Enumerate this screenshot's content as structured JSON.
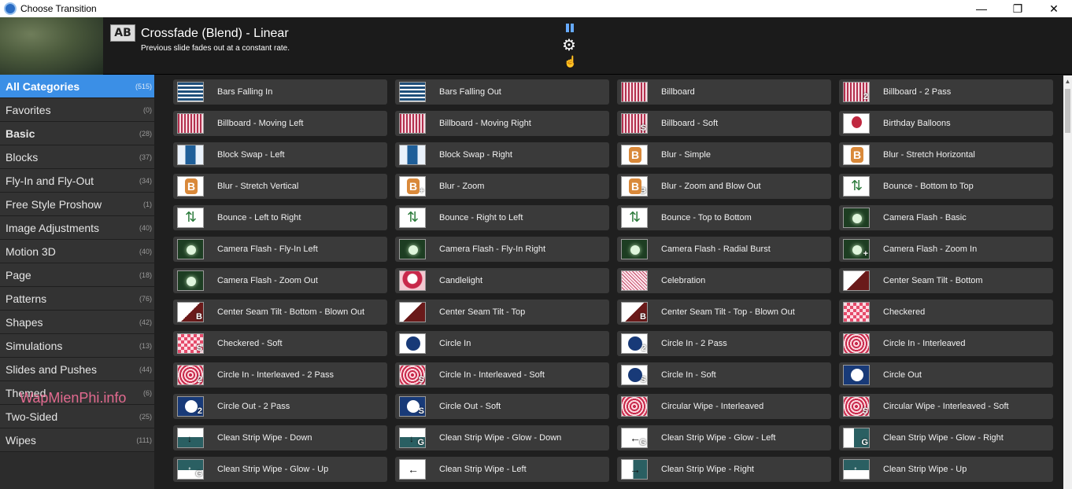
{
  "window": {
    "title": "Choose Transition",
    "controls": [
      "—",
      "❐",
      "✕"
    ]
  },
  "header": {
    "ab_icon_text": "AB",
    "title": "Crossfade (Blend) - Linear",
    "description": "Previous slide fades out at a constant rate."
  },
  "sidebar": {
    "categories": [
      {
        "name": "All Categories",
        "count": "(515)"
      },
      {
        "name": "Favorites",
        "count": "(0)"
      },
      {
        "name": "Basic",
        "count": "(28)"
      },
      {
        "name": "Blocks",
        "count": "(37)"
      },
      {
        "name": "Fly-In and Fly-Out",
        "count": "(34)"
      },
      {
        "name": "Free Style Proshow",
        "count": "(1)"
      },
      {
        "name": "Image Adjustments",
        "count": "(40)"
      },
      {
        "name": "Motion 3D",
        "count": "(40)"
      },
      {
        "name": "Page",
        "count": "(18)"
      },
      {
        "name": "Patterns",
        "count": "(76)"
      },
      {
        "name": "Shapes",
        "count": "(42)"
      },
      {
        "name": "Simulations",
        "count": "(13)"
      },
      {
        "name": "Slides and Pushes",
        "count": "(44)"
      },
      {
        "name": "Themed",
        "count": "(6)"
      },
      {
        "name": "Two-Sided",
        "count": "(25)"
      },
      {
        "name": "Wipes",
        "count": "(111)"
      }
    ],
    "watermark": "WapMienPhi.info"
  },
  "transitions": [
    {
      "label": "Bars Falling In",
      "icon": "bars-icon",
      "badge": ""
    },
    {
      "label": "Bars Falling Out",
      "icon": "bars-icon",
      "badge": ""
    },
    {
      "label": "Billboard",
      "icon": "billboard-icon",
      "badge": ""
    },
    {
      "label": "Billboard - 2 Pass",
      "icon": "billboard-icon",
      "badge": "2"
    },
    {
      "label": "Billboard - Moving Left",
      "icon": "billboard-icon",
      "badge": ""
    },
    {
      "label": "Billboard - Moving Right",
      "icon": "billboard-icon",
      "badge": ""
    },
    {
      "label": "Billboard - Soft",
      "icon": "billboard-icon",
      "badge": "S"
    },
    {
      "label": "Birthday Balloons",
      "icon": "balloon-icon",
      "badge": ""
    },
    {
      "label": "Block Swap - Left",
      "icon": "block-icon",
      "badge": ""
    },
    {
      "label": "Block Swap - Right",
      "icon": "block-icon",
      "badge": ""
    },
    {
      "label": "Blur - Simple",
      "icon": "blur-icon",
      "badge": ""
    },
    {
      "label": "Blur - Stretch Horizontal",
      "icon": "blur-icon",
      "badge": ""
    },
    {
      "label": "Blur - Stretch Vertical",
      "icon": "blur-icon",
      "badge": ""
    },
    {
      "label": "Blur - Zoom",
      "icon": "blur-icon",
      "badge": "+"
    },
    {
      "label": "Blur - Zoom and Blow Out",
      "icon": "blur-icon",
      "badge": "B"
    },
    {
      "label": "Bounce - Bottom to Top",
      "icon": "bounce-icon",
      "badge": ""
    },
    {
      "label": "Bounce - Left to Right",
      "icon": "bounce-icon",
      "badge": ""
    },
    {
      "label": "Bounce - Right to Left",
      "icon": "bounce-icon",
      "badge": ""
    },
    {
      "label": "Bounce - Top to Bottom",
      "icon": "bounce-icon",
      "badge": ""
    },
    {
      "label": "Camera Flash - Basic",
      "icon": "camera-flash-icon",
      "badge": ""
    },
    {
      "label": "Camera Flash - Fly-In Left",
      "icon": "camera-flash-icon",
      "badge": ""
    },
    {
      "label": "Camera Flash - Fly-In Right",
      "icon": "camera-flash-icon",
      "badge": ""
    },
    {
      "label": "Camera Flash - Radial Burst",
      "icon": "camera-flash-icon",
      "badge": ""
    },
    {
      "label": "Camera Flash - Zoom In",
      "icon": "camera-flash-icon",
      "badge": "+"
    },
    {
      "label": "Camera Flash - Zoom Out",
      "icon": "camera-flash-icon",
      "badge": ""
    },
    {
      "label": "Candlelight",
      "icon": "candle-icon",
      "badge": ""
    },
    {
      "label": "Celebration",
      "icon": "celebration-icon",
      "badge": ""
    },
    {
      "label": "Center Seam Tilt - Bottom",
      "icon": "seam-icon",
      "badge": ""
    },
    {
      "label": "Center Seam Tilt - Bottom - Blown Out",
      "icon": "seam-icon",
      "badge": "B"
    },
    {
      "label": "Center Seam Tilt - Top",
      "icon": "seam-icon",
      "badge": ""
    },
    {
      "label": "Center Seam Tilt - Top - Blown Out",
      "icon": "seam-icon",
      "badge": "B"
    },
    {
      "label": "Checkered",
      "icon": "checkered-icon",
      "badge": ""
    },
    {
      "label": "Checkered - Soft",
      "icon": "checkered-icon",
      "badge": "S"
    },
    {
      "label": "Circle In",
      "icon": "circle-in-icon",
      "badge": ""
    },
    {
      "label": "Circle In - 2 Pass",
      "icon": "circle-in-icon",
      "badge": "2"
    },
    {
      "label": "Circle In - Interleaved",
      "icon": "rings-icon",
      "badge": ""
    },
    {
      "label": "Circle In - Interleaved - 2 Pass",
      "icon": "rings-icon",
      "badge": "2"
    },
    {
      "label": "Circle In - Interleaved - Soft",
      "icon": "rings-icon",
      "badge": "S"
    },
    {
      "label": "Circle In - Soft",
      "icon": "circle-in-icon",
      "badge": "S"
    },
    {
      "label": "Circle Out",
      "icon": "circle-out-icon",
      "badge": ""
    },
    {
      "label": "Circle Out - 2 Pass",
      "icon": "circle-out-icon",
      "badge": "2"
    },
    {
      "label": "Circle Out - Soft",
      "icon": "circle-out-icon",
      "badge": "S"
    },
    {
      "label": "Circular Wipe - Interleaved",
      "icon": "rings-icon",
      "badge": ""
    },
    {
      "label": "Circular Wipe - Interleaved - Soft",
      "icon": "rings-icon",
      "badge": "S"
    },
    {
      "label": "Clean Strip Wipe - Down",
      "icon": "strip-down-icon",
      "badge": ""
    },
    {
      "label": "Clean Strip Wipe - Glow - Down",
      "icon": "strip-down-icon",
      "badge": "G"
    },
    {
      "label": "Clean Strip Wipe - Glow - Left",
      "icon": "strip-left-icon",
      "badge": "G"
    },
    {
      "label": "Clean Strip Wipe - Glow - Right",
      "icon": "strip-glow-right-icon",
      "badge": "G"
    },
    {
      "label": "Clean Strip Wipe - Glow - Up",
      "icon": "strip-up-icon",
      "badge": "G"
    },
    {
      "label": "Clean Strip Wipe - Left",
      "icon": "strip-left-icon",
      "badge": ""
    },
    {
      "label": "Clean Strip Wipe - Right",
      "icon": "strip-right-icon",
      "badge": ""
    },
    {
      "label": "Clean Strip Wipe - Up",
      "icon": "strip-up-icon",
      "badge": ""
    }
  ],
  "colors": {
    "accent": "#3b8fe6",
    "tile_bg": "#3a3a3a",
    "watermark": "#e26a8f"
  }
}
